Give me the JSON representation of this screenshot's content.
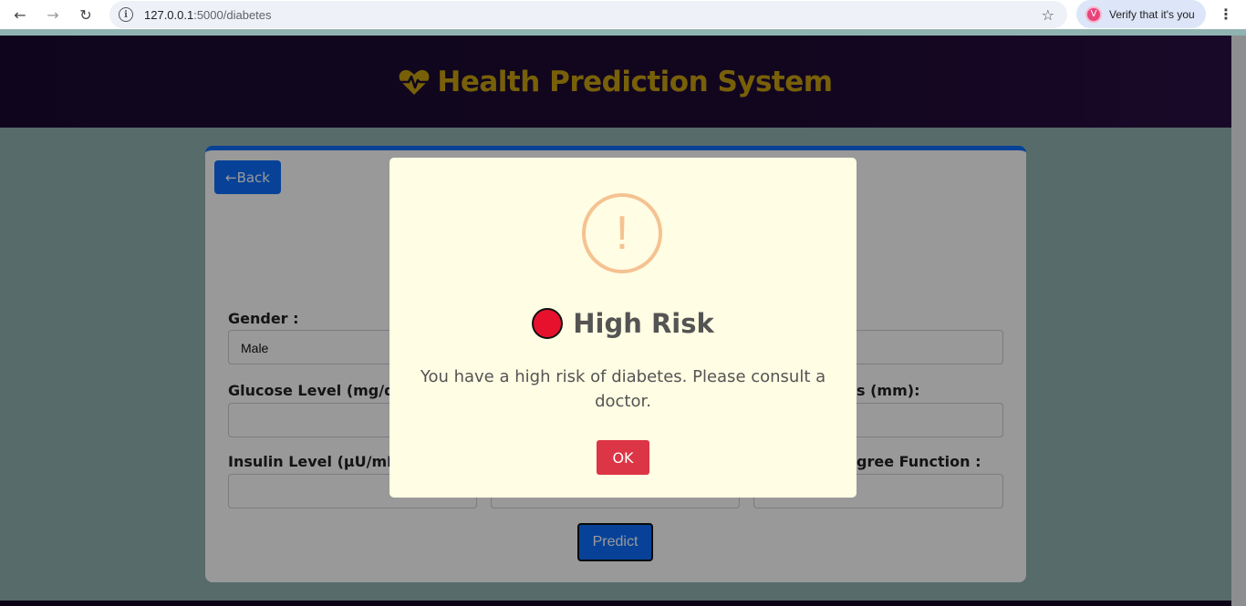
{
  "browser": {
    "url_host": "127.0.0.1",
    "url_path": ":5000/diabetes",
    "profile_initial": "V",
    "profile_label": "Verify that it's you"
  },
  "header": {
    "title": "Health Prediction System",
    "brand_color": "#c9a00f",
    "icon": "heartbeat-icon"
  },
  "form": {
    "back_label": "←Back",
    "gender_label": "Gender :",
    "gender_value": "Male",
    "glucose_label": "Glucose Level (mg/dL)",
    "skin_label": "s (mm):",
    "insulin_label": "Insulin Level (μU/mL):",
    "pedigree_label": "gree Function :",
    "predict_label": "Predict",
    "accent": "#0d6efd"
  },
  "modal": {
    "icon": "warning-icon",
    "icon_glyph": "!",
    "title": "High Risk",
    "status_color": "#e8112d",
    "message": "You have a high risk of diabetes. Please consult a doctor.",
    "ok_label": "OK",
    "ok_color": "#dc3545"
  }
}
